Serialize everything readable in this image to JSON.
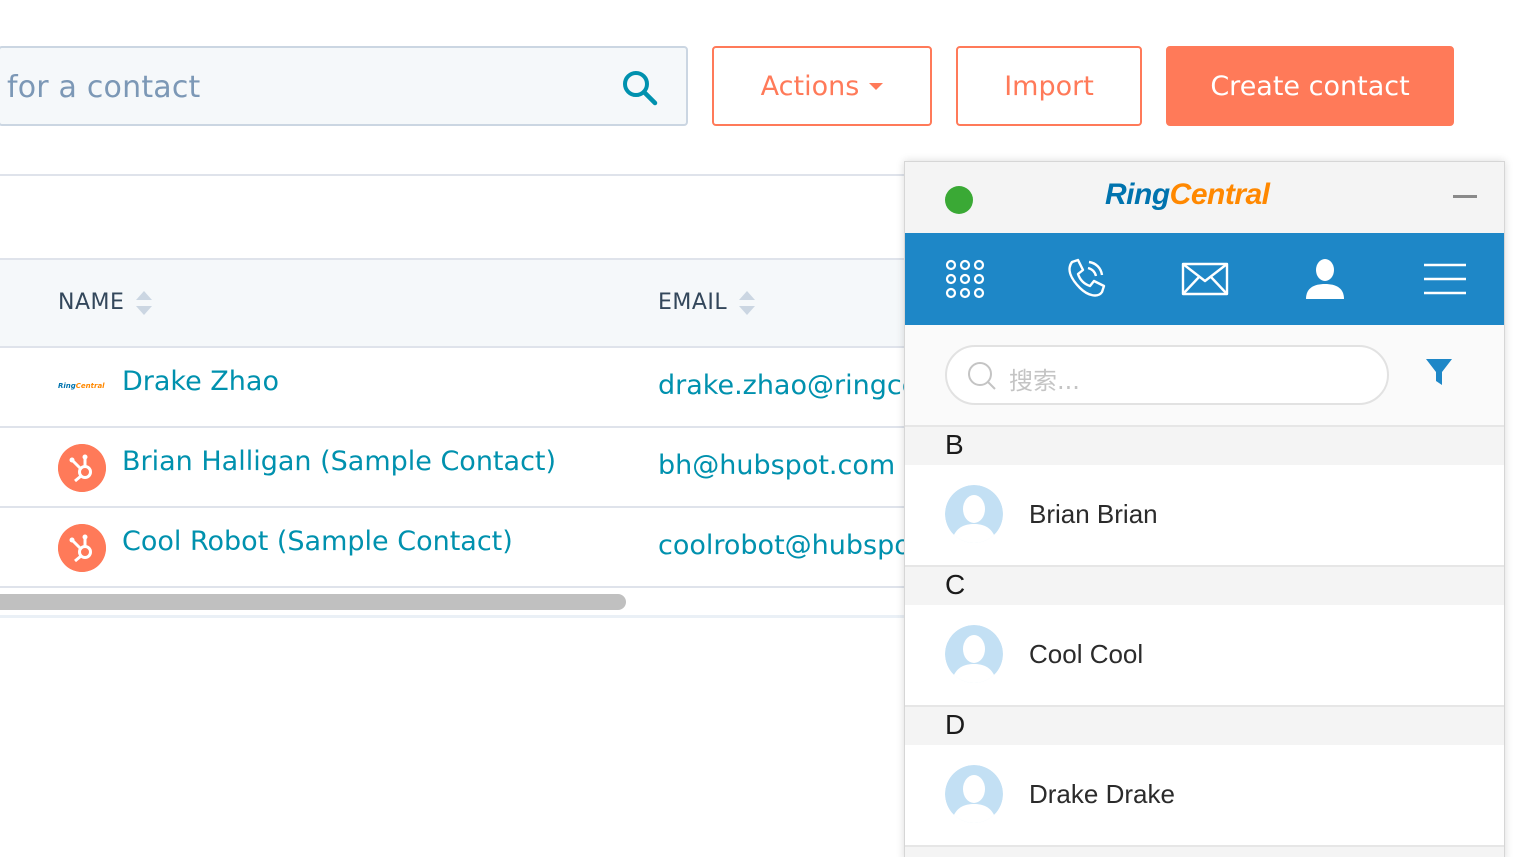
{
  "search": {
    "placeholder": "h for a contact"
  },
  "toolbar": {
    "actions_label": "Actions",
    "import_label": "Import",
    "create_label": "Create contact"
  },
  "table": {
    "columns": [
      "NAME",
      "EMAIL"
    ],
    "rows": [
      {
        "name": "Drake Zhao",
        "email": "drake.zhao@ringce",
        "avatar": "ringcentral-logo"
      },
      {
        "name": "Brian Halligan (Sample Contact)",
        "email": "bh@hubspot.com",
        "avatar": "hubspot-logo"
      },
      {
        "name": "Cool Robot (Sample Contact)",
        "email": "coolrobot@hubspo",
        "avatar": "hubspot-logo"
      }
    ]
  },
  "widget": {
    "logo_ring": "Ring",
    "logo_central": "Central",
    "status_color": "#3aa935",
    "nav_color": "#1e87c7",
    "search_placeholder": "搜索...",
    "sections": [
      {
        "letter": "B",
        "contacts": [
          "Brian Brian"
        ]
      },
      {
        "letter": "C",
        "contacts": [
          "Cool Cool"
        ]
      },
      {
        "letter": "D",
        "contacts": [
          "Drake Drake"
        ]
      }
    ]
  },
  "colors": {
    "accent": "#ff7a59",
    "link": "#0091ae",
    "text": "#33475b"
  }
}
